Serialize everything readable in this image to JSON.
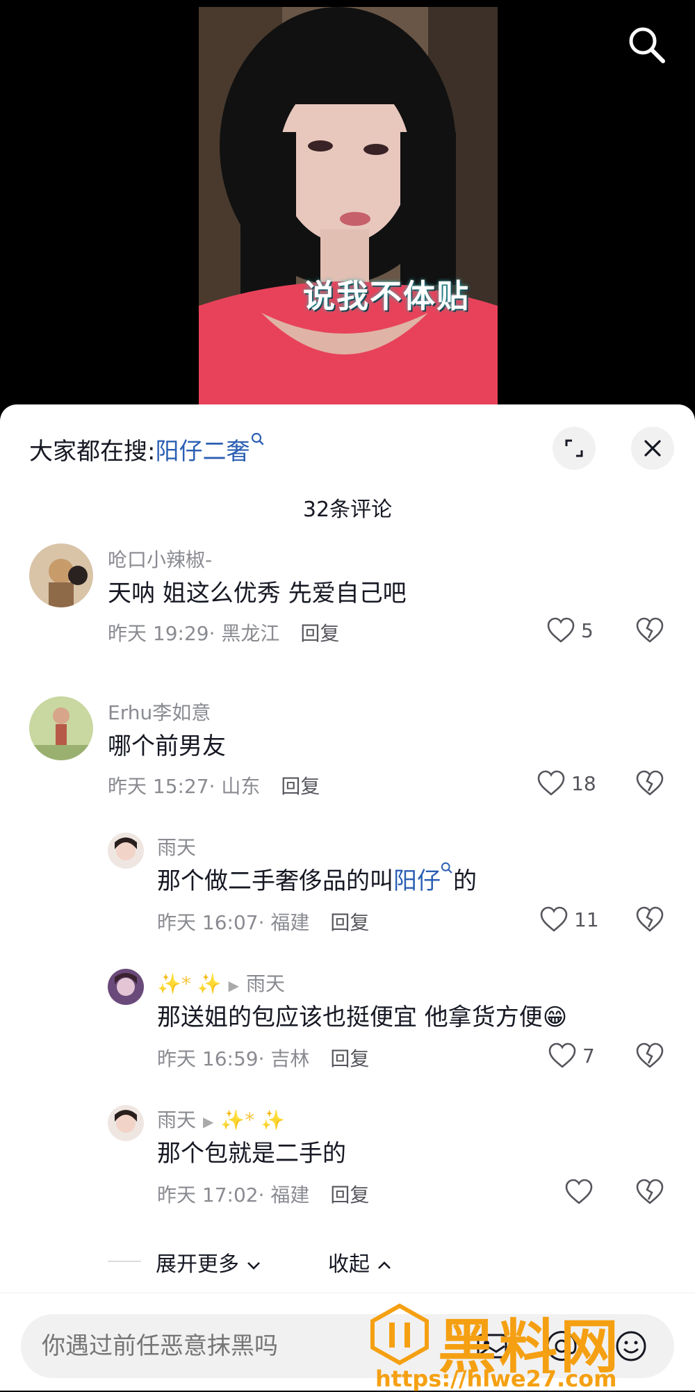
{
  "video": {
    "caption": "说我不体贴"
  },
  "sheet": {
    "hot_search_label": "大家都在搜:",
    "hot_search_keyword": "阳仔二奢",
    "comment_count": "32条评论"
  },
  "comments": [
    {
      "user": "呛口小辣椒-",
      "text": "天呐 姐这么优秀 先爱自己吧",
      "time": "昨天 19:29",
      "region": "黑龙江",
      "reply": "回复",
      "likes": "5"
    },
    {
      "user": "Erhu李如意",
      "text": "哪个前男友",
      "time": "昨天 15:27",
      "region": "山东",
      "reply": "回复",
      "likes": "18"
    }
  ],
  "replies": [
    {
      "user": "雨天",
      "to": "",
      "text_before": "那个做二手奢侈品的叫",
      "keyword": "阳仔",
      "text_after": "的",
      "time": "昨天 16:07",
      "region": "福建",
      "reply": "回复",
      "likes": "11"
    },
    {
      "user": "✨* ✨",
      "to": "雨天",
      "text": "那送姐的包应该也挺便宜 他拿货方便😁",
      "time": "昨天 16:59",
      "region": "吉林",
      "reply": "回复",
      "likes": "7"
    },
    {
      "user": "雨天",
      "to": "✨* ✨",
      "text": "那个包就是二手的",
      "time": "昨天 17:02",
      "region": "福建",
      "reply": "回复",
      "likes": ""
    }
  ],
  "actions": {
    "expand_more": "展开更多",
    "collapse": "收起"
  },
  "input": {
    "placeholder": "你遇过前任恶意抹黑吗"
  },
  "watermark": {
    "text": "黑料网",
    "url": "https://hlwe27.com"
  },
  "colors": {
    "keyword": "#2b5fb3",
    "watermark": "#f5a012"
  }
}
